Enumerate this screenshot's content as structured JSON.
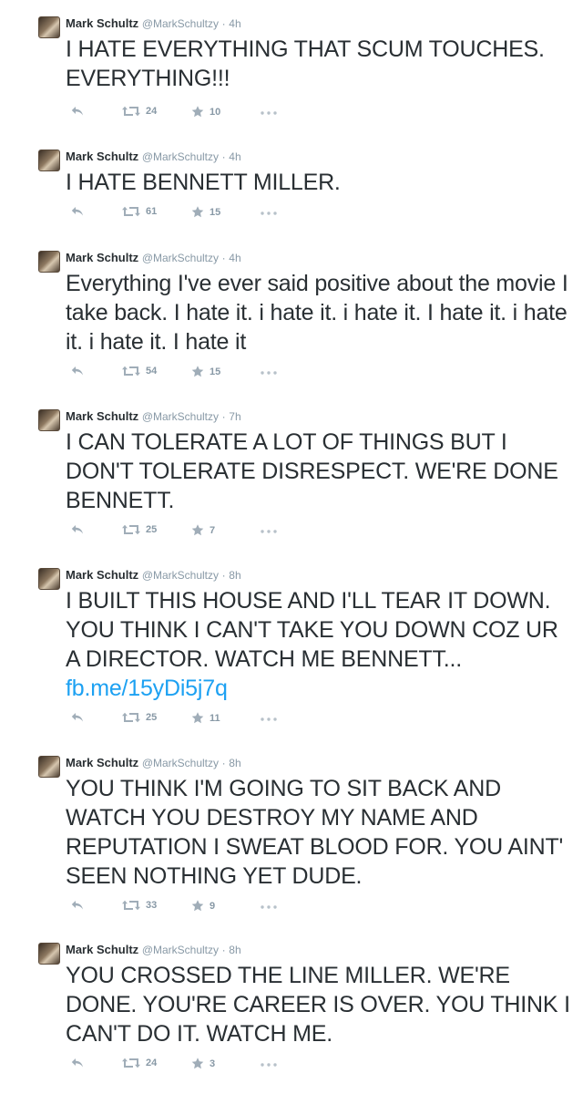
{
  "tweets": [
    {
      "author": "Mark Schultz",
      "handle": "@MarkSchultzy",
      "time": "4h",
      "text": "I HATE EVERYTHING THAT SCUM TOUCHES. EVERYTHING!!!",
      "link": "",
      "retweets": "24",
      "favorites": "10"
    },
    {
      "author": "Mark Schultz",
      "handle": "@MarkSchultzy",
      "time": "4h",
      "text": "I HATE BENNETT MILLER.",
      "link": "",
      "retweets": "61",
      "favorites": "15"
    },
    {
      "author": "Mark Schultz",
      "handle": "@MarkSchultzy",
      "time": "4h",
      "text": "Everything I've ever said positive about the movie I take back. I hate it. i hate it. i hate it. I hate it. i hate it. i hate it. I hate it",
      "link": "",
      "retweets": "54",
      "favorites": "15"
    },
    {
      "author": "Mark Schultz",
      "handle": "@MarkSchultzy",
      "time": "7h",
      "text": "I CAN TOLERATE A LOT OF THINGS BUT I DON'T TOLERATE DISRESPECT. WE'RE DONE BENNETT.",
      "link": "",
      "retweets": "25",
      "favorites": "7"
    },
    {
      "author": "Mark Schultz",
      "handle": "@MarkSchultzy",
      "time": "8h",
      "text": "I BUILT THIS HOUSE AND I'LL TEAR IT DOWN. YOU THINK I CAN'T TAKE YOU DOWN COZ UR A DIRECTOR. WATCH ME BENNETT... ",
      "link": "fb.me/15yDi5j7q",
      "retweets": "25",
      "favorites": "11"
    },
    {
      "author": "Mark Schultz",
      "handle": "@MarkSchultzy",
      "time": "8h",
      "text": "YOU THINK I'M GOING TO SIT BACK AND WATCH YOU DESTROY MY NAME AND REPUTATION I SWEAT BLOOD FOR. YOU AINT' SEEN NOTHING YET DUDE.",
      "link": "",
      "retweets": "33",
      "favorites": "9"
    },
    {
      "author": "Mark Schultz",
      "handle": "@MarkSchultzy",
      "time": "8h",
      "text": "YOU CROSSED THE LINE MILLER. WE'RE DONE. YOU'RE CAREER IS OVER. YOU THINK I CAN'T DO IT. WATCH ME.",
      "link": "",
      "retweets": "24",
      "favorites": "3"
    }
  ],
  "separator": "·",
  "icons": {
    "reply": "reply-icon",
    "retweet": "retweet-icon",
    "favorite": "star-icon",
    "more": "more-icon"
  },
  "colors": {
    "text": "#292f33",
    "muted": "#8899a6",
    "link": "#1da1f2"
  }
}
